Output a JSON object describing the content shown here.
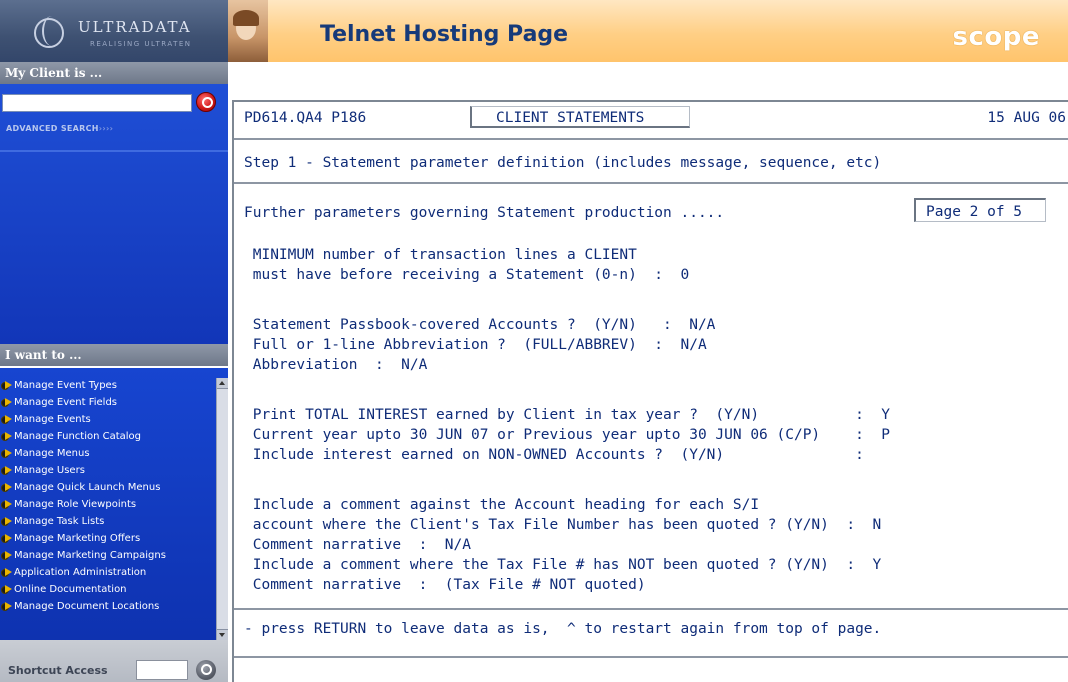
{
  "sidebar": {
    "brand": {
      "name": "ULTRADATA",
      "tagline": "REALISING ULTRATEN"
    },
    "client_section": {
      "title": "My Client is ...",
      "search_value": "",
      "advanced_search_label": "ADVANCED SEARCH",
      "advanced_search_arrows": "››››"
    },
    "menu_section": {
      "title": "I want to ...",
      "items": [
        {
          "label": "Manage Event Types"
        },
        {
          "label": "Manage Event Fields"
        },
        {
          "label": "Manage Events"
        },
        {
          "label": "Manage Function Catalog"
        },
        {
          "label": "Manage Menus"
        },
        {
          "label": "Manage Users"
        },
        {
          "label": "Manage Quick Launch Menus"
        },
        {
          "label": "Manage Role Viewpoints"
        },
        {
          "label": "Manage Task Lists"
        },
        {
          "label": "Manage Marketing Offers"
        },
        {
          "label": "Manage Marketing Campaigns"
        },
        {
          "label": "Application Administration"
        },
        {
          "label": "Online Documentation"
        },
        {
          "label": "Manage Document Locations"
        }
      ]
    },
    "shortcut": {
      "label": "Shortcut Access",
      "value": ""
    }
  },
  "banner": {
    "title": "Telnet Hosting Page",
    "logo_text": "scope"
  },
  "terminal": {
    "header": {
      "program": "PD614.QA4 P186",
      "title": "CLIENT STATEMENTS",
      "date": "15 AUG 06"
    },
    "step_line": "Step 1 - Statement parameter definition (includes message, sequence, etc)",
    "section_line": "Further parameters governing Statement production .....",
    "page_indicator": "Page 2 of 5",
    "body_lines": [
      " MINIMUM number of transaction lines a CLIENT",
      " must have before receiving a Statement (0-n)  :  0",
      "",
      " Statement Passbook-covered Accounts ?  (Y/N)   :  N/A",
      " Full or 1-line Abbreviation ?  (FULL/ABBREV)  :  N/A",
      " Abbreviation  :  N/A",
      "",
      " Print TOTAL INTEREST earned by Client in tax year ?  (Y/N)           :  Y",
      " Current year upto 30 JUN 07 or Previous year upto 30 JUN 06 (C/P)    :  P",
      " Include interest earned on NON-OWNED Accounts ?  (Y/N)               :",
      "",
      " Include a comment against the Account heading for each S/I",
      " account where the Client's Tax File Number has been quoted ? (Y/N)  :  N",
      " Comment narrative  :  N/A",
      " Include a comment where the Tax File # has NOT been quoted ? (Y/N)  :  Y",
      " Comment narrative  :  (Tax File # NOT quoted)"
    ],
    "footer_line": "- press RETURN to leave data as is,  ^ to restart again from top of page."
  },
  "colors": {
    "sidebar_blue": "#1745d0",
    "banner_orange": "#ffc46c",
    "terminal_text": "#0f2c78",
    "banner_title": "#163a7a"
  }
}
